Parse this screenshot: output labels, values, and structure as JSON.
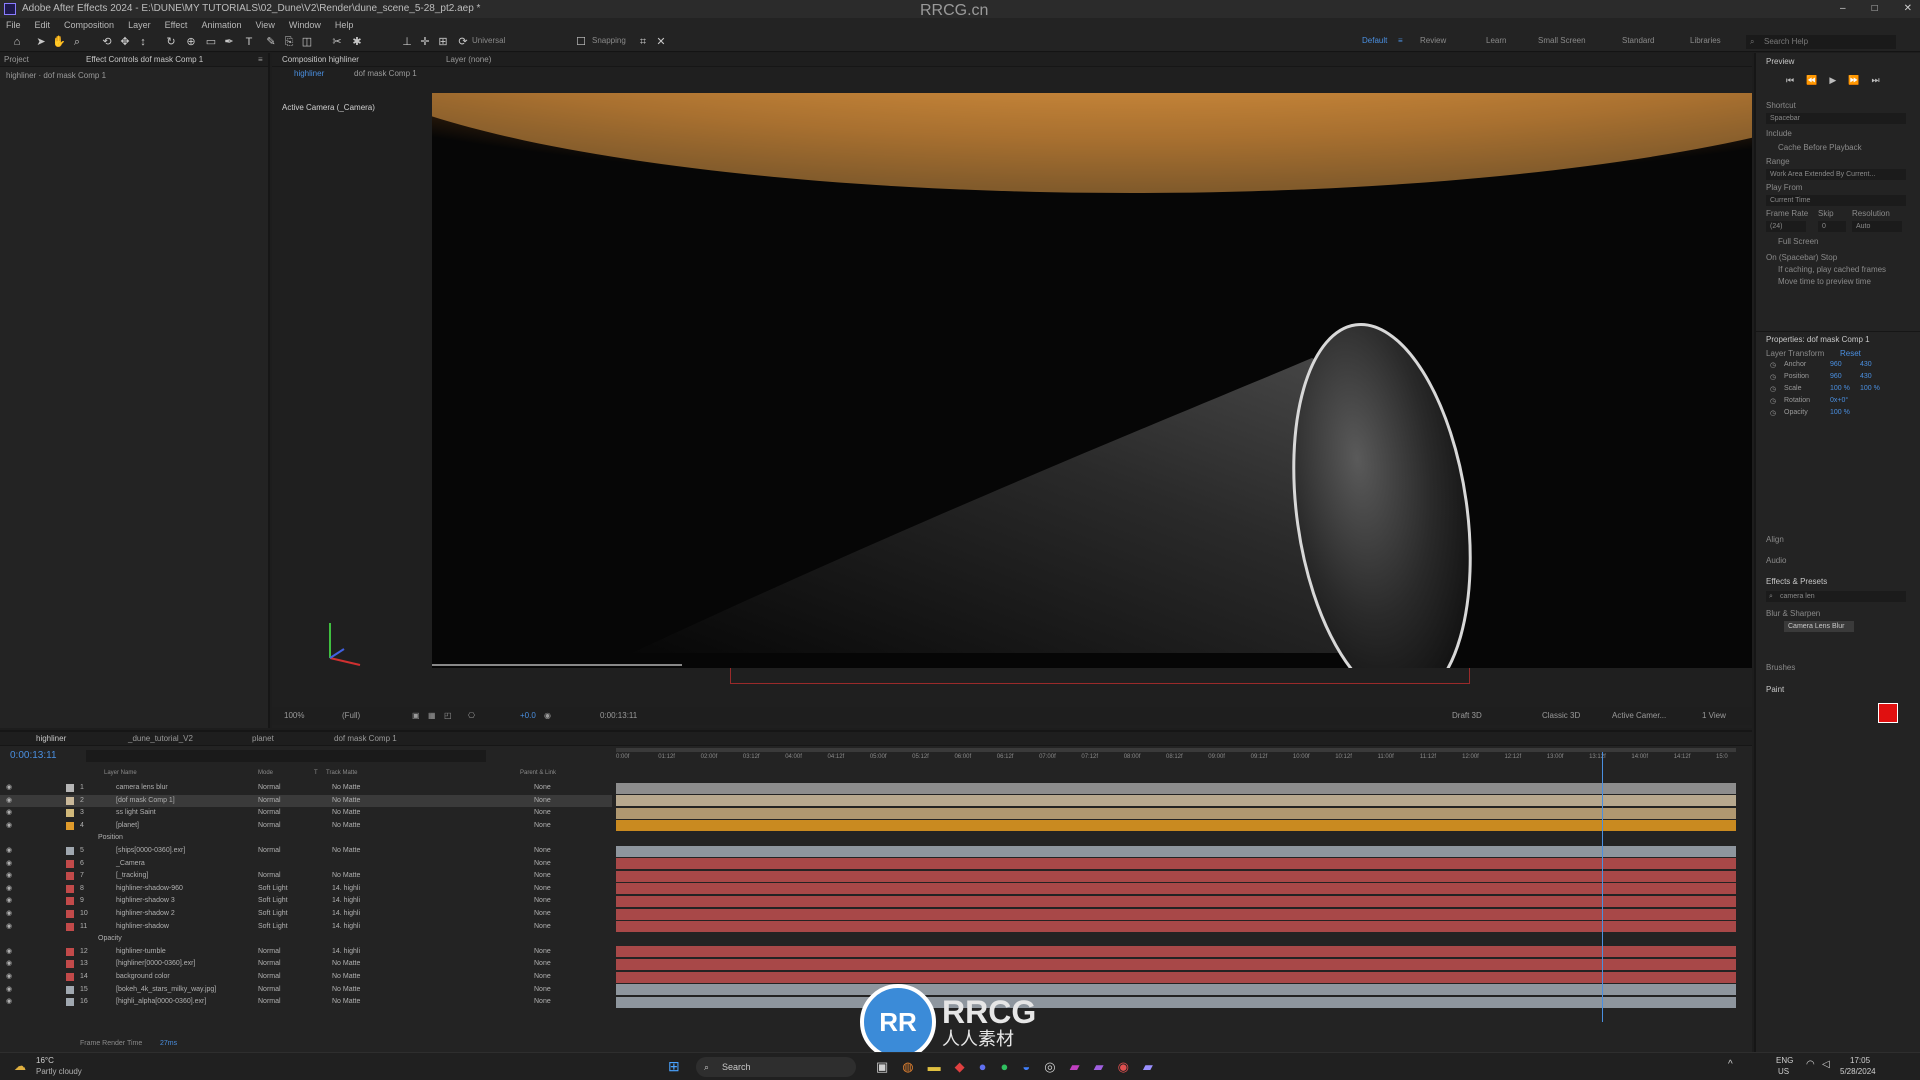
{
  "window": {
    "title": "Adobe After Effects 2024 - E:\\DUNE\\MY TUTORIALS\\02_Dune\\V2\\Render\\dune_scene_5-28_pt2.aep *",
    "watermark": "RRCG.cn"
  },
  "menu": [
    "File",
    "Edit",
    "Composition",
    "Layer",
    "Effect",
    "Animation",
    "View",
    "Window",
    "Help"
  ],
  "toolbar": {
    "workspaces": [
      "Default",
      "Review",
      "Learn",
      "Small Screen",
      "Standard",
      "Libraries"
    ],
    "active_workspace": "Default",
    "search_placeholder": "Search Help",
    "universal": "Universal",
    "snapping": "Snapping"
  },
  "left_panel": {
    "tabs": [
      "Project",
      "Effect Controls dof mask Comp 1"
    ],
    "subtitle": "highliner · dof mask Comp 1"
  },
  "comp_panel": {
    "tab": "Composition highliner",
    "layer_tab": "Layer (none)",
    "subtabs": [
      "highliner",
      "dof mask Comp 1"
    ],
    "camera_label": "Active Camera (_Camera)",
    "zoom": "100%",
    "resolution": "(Full)",
    "timecode": "0:00:13:11",
    "renderer": "Draft 3D",
    "renderer2": "Classic 3D",
    "view": "Active Camer...",
    "views": "1 View"
  },
  "right_panel": {
    "preview_title": "Preview",
    "shortcut_label": "Shortcut",
    "shortcut_value": "Spacebar",
    "include_label": "Include",
    "cache_label": "Cache Before Playback",
    "range_label": "Range",
    "range_value": "Work Area Extended By Current...",
    "play_from_label": "Play From",
    "play_from_value": "Current Time",
    "frame_rate_label": "Frame Rate",
    "skip_label": "Skip",
    "resolution_label": "Resolution",
    "frame_rate_value": "(24)",
    "skip_value": "0",
    "resolution_value": "Auto",
    "full_screen": "Full Screen",
    "on_stop": "On (Spacebar) Stop",
    "if_caching": "If caching, play cached frames",
    "move_time": "Move time to preview time",
    "properties_title": "Properties: dof mask Comp 1",
    "layer_transform": "Layer Transform",
    "reset": "Reset",
    "props": [
      {
        "name": "Anchor",
        "v1": "960",
        "v2": "430"
      },
      {
        "name": "Position",
        "v1": "960",
        "v2": "430"
      },
      {
        "name": "Scale",
        "v1": "100 %",
        "v2": "100 %"
      },
      {
        "name": "Rotation",
        "v1": "0x+0°",
        "v2": ""
      },
      {
        "name": "Opacity",
        "v1": "100 %",
        "v2": ""
      }
    ],
    "align": "Align",
    "audio": "Audio",
    "effects_title": "Effects & Presets",
    "effects_search": "camera len",
    "effects_category": "Blur & Sharpen",
    "effects_item": "Camera Lens Blur",
    "brushes": "Brushes",
    "paint": "Paint",
    "paint_color": "#e01010"
  },
  "timeline": {
    "tabs": [
      "highliner",
      "_dune_tutorial_V2",
      "planet",
      "dof mask Comp 1"
    ],
    "current_time": "0:00:13:11",
    "columns": [
      "Layer Name",
      "Mode",
      "T",
      "Track Matte",
      "Parent & Link"
    ],
    "ruler": [
      "0:00f",
      "01:12f",
      "02:00f",
      "03:12f",
      "04:00f",
      "04:12f",
      "05:00f",
      "05:12f",
      "06:00f",
      "06:12f",
      "07:00f",
      "07:12f",
      "08:00f",
      "08:12f",
      "09:00f",
      "09:12f",
      "10:00f",
      "10:12f",
      "11:00f",
      "11:12f",
      "12:00f",
      "12:12f",
      "13:00f",
      "13:12f",
      "14:00f",
      "14:12f",
      "15:0"
    ],
    "layers": [
      {
        "num": "1",
        "name": "camera lens blur",
        "mode": "Normal",
        "matte": "No Matte",
        "parent": "None",
        "color": "#b5b5b5",
        "track": "#8d8d8d"
      },
      {
        "num": "2",
        "name": "[dof mask Comp 1]",
        "mode": "Normal",
        "matte": "No Matte",
        "parent": "None",
        "color": "#c9b89a",
        "track": "#b7a88e"
      },
      {
        "num": "3",
        "name": "ss light Saint",
        "mode": "Normal",
        "matte": "No Matte",
        "parent": "None",
        "color": "#d0b87a",
        "track": "#b09870"
      },
      {
        "num": "4",
        "name": "[planet]",
        "mode": "Normal",
        "matte": "No Matte",
        "parent": "None",
        "color": "#e09b2b",
        "track": "#c98a20"
      },
      {
        "num": "",
        "name": "Position",
        "mode": "",
        "matte": "",
        "parent": "",
        "color": "",
        "track": ""
      },
      {
        "num": "5",
        "name": "[ships[0000-0360].exr]",
        "mode": "Normal",
        "matte": "No Matte",
        "parent": "None",
        "color": "#a0a8b0",
        "track": "#8e969e"
      },
      {
        "num": "6",
        "name": "_Camera",
        "mode": "",
        "matte": "",
        "parent": "None",
        "color": "#c24a4a",
        "track": "#a84848"
      },
      {
        "num": "7",
        "name": "[_tracking]",
        "mode": "Normal",
        "matte": "No Matte",
        "parent": "None",
        "color": "#c24a4a",
        "track": "#a84848"
      },
      {
        "num": "8",
        "name": "highliner-shadow-960",
        "mode": "Soft Light",
        "matte": "14. highli",
        "parent": "None",
        "color": "#c24a4a",
        "track": "#a84848"
      },
      {
        "num": "9",
        "name": "highliner-shadow 3",
        "mode": "Soft Light",
        "matte": "14. highli",
        "parent": "None",
        "color": "#c24a4a",
        "track": "#a84848"
      },
      {
        "num": "10",
        "name": "highliner-shadow 2",
        "mode": "Soft Light",
        "matte": "14. highli",
        "parent": "None",
        "color": "#c24a4a",
        "track": "#a84848"
      },
      {
        "num": "11",
        "name": "highliner-shadow",
        "mode": "Soft Light",
        "matte": "14. highli",
        "parent": "None",
        "color": "#c24a4a",
        "track": "#a84848"
      },
      {
        "num": "",
        "name": "Opacity",
        "mode": "",
        "matte": "",
        "parent": "",
        "color": "",
        "track": ""
      },
      {
        "num": "12",
        "name": "highliner-tumble",
        "mode": "Normal",
        "matte": "14. highli",
        "parent": "None",
        "color": "#c24a4a",
        "track": "#a84848"
      },
      {
        "num": "13",
        "name": "[highliner[0000-0360].exr]",
        "mode": "Normal",
        "matte": "No Matte",
        "parent": "None",
        "color": "#c24a4a",
        "track": "#a84848"
      },
      {
        "num": "14",
        "name": "background color",
        "mode": "Normal",
        "matte": "No Matte",
        "parent": "None",
        "color": "#c24a4a",
        "track": "#a84848"
      },
      {
        "num": "15",
        "name": "[bokeh_4k_stars_milky_way.jpg]",
        "mode": "Normal",
        "matte": "No Matte",
        "parent": "None",
        "color": "#a0a8b0",
        "track": "#8e969e"
      },
      {
        "num": "16",
        "name": "[highli_alpha[0000-0360].exr]",
        "mode": "Normal",
        "matte": "No Matte",
        "parent": "None",
        "color": "#a0a8b0",
        "track": "#8e969e"
      }
    ],
    "render_time_label": "Frame Render Time",
    "render_time": "27ms"
  },
  "taskbar": {
    "weather_temp": "16°C",
    "weather_desc": "Partly cloudy",
    "search_label": "Search",
    "lang": "ENG",
    "region": "US",
    "clock_time": "17:05",
    "clock_date": "5/28/2024"
  },
  "logo": {
    "text": "RRCG",
    "subtext": "人人素材"
  }
}
